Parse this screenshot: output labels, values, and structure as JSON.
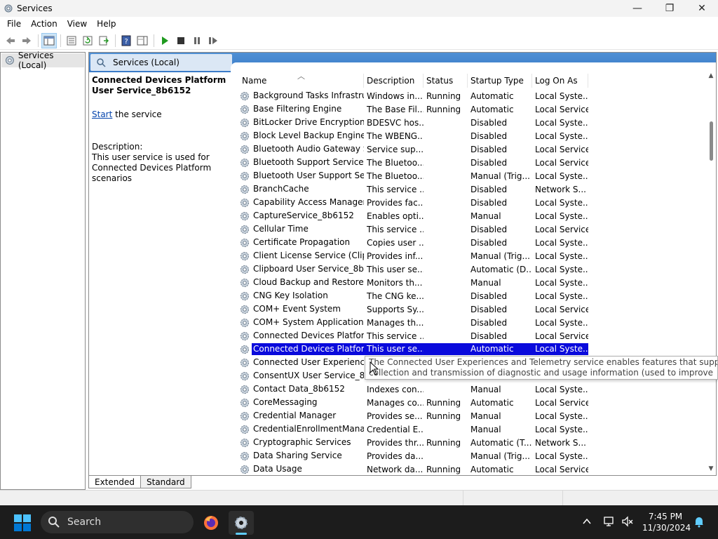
{
  "window": {
    "title": "Services",
    "minimize": "—",
    "maximize": "❐",
    "close": "✕"
  },
  "menu": [
    "File",
    "Action",
    "View",
    "Help"
  ],
  "tree": {
    "root_label": "Services (Local)"
  },
  "main_header": {
    "title": "Services (Local)"
  },
  "description": {
    "service_title": "Connected Devices Platform User Service_8b6152",
    "start_link": "Start",
    "start_suffix": " the service",
    "label": "Description:",
    "text": "This user service is used for Connected Devices Platform scenarios"
  },
  "columns": {
    "name": "Name",
    "description": "Description",
    "status": "Status",
    "startup_type": "Startup Type",
    "log_on_as": "Log On As"
  },
  "rows": [
    {
      "name": "Background Tasks Infrastru...",
      "description": "Windows in...",
      "status": "Running",
      "startup": "Automatic",
      "logon": "Local Syste..."
    },
    {
      "name": "Base Filtering Engine",
      "description": "The Base Fil...",
      "status": "Running",
      "startup": "Automatic",
      "logon": "Local Service"
    },
    {
      "name": "BitLocker Drive Encryption ...",
      "description": "BDESVC hos...",
      "status": "",
      "startup": "Disabled",
      "logon": "Local Syste..."
    },
    {
      "name": "Block Level Backup Engine ...",
      "description": "The WBENG...",
      "status": "",
      "startup": "Disabled",
      "logon": "Local Syste..."
    },
    {
      "name": "Bluetooth Audio Gateway S...",
      "description": "Service sup...",
      "status": "",
      "startup": "Disabled",
      "logon": "Local Service"
    },
    {
      "name": "Bluetooth Support Service",
      "description": "The Bluetoo...",
      "status": "",
      "startup": "Disabled",
      "logon": "Local Service"
    },
    {
      "name": "Bluetooth User Support Ser...",
      "description": "The Bluetoo...",
      "status": "",
      "startup": "Manual (Trig...",
      "logon": "Local Syste..."
    },
    {
      "name": "BranchCache",
      "description": "This service ...",
      "status": "",
      "startup": "Disabled",
      "logon": "Network S..."
    },
    {
      "name": "Capability Access Manager ...",
      "description": "Provides fac...",
      "status": "",
      "startup": "Disabled",
      "logon": "Local Syste..."
    },
    {
      "name": "CaptureService_8b6152",
      "description": "Enables opti...",
      "status": "",
      "startup": "Manual",
      "logon": "Local Syste..."
    },
    {
      "name": "Cellular Time",
      "description": "This service ...",
      "status": "",
      "startup": "Disabled",
      "logon": "Local Service"
    },
    {
      "name": "Certificate Propagation",
      "description": "Copies user ...",
      "status": "",
      "startup": "Disabled",
      "logon": "Local Syste..."
    },
    {
      "name": "Client License Service (ClipS...",
      "description": "Provides inf...",
      "status": "",
      "startup": "Manual (Trig...",
      "logon": "Local Syste..."
    },
    {
      "name": "Clipboard User Service_8b6...",
      "description": "This user se...",
      "status": "",
      "startup": "Automatic (D...",
      "logon": "Local Syste..."
    },
    {
      "name": "Cloud Backup and Restore ...",
      "description": "Monitors th...",
      "status": "",
      "startup": "Manual",
      "logon": "Local Syste..."
    },
    {
      "name": "CNG Key Isolation",
      "description": "The CNG ke...",
      "status": "",
      "startup": "Disabled",
      "logon": "Local Syste..."
    },
    {
      "name": "COM+ Event System",
      "description": "Supports Sy...",
      "status": "",
      "startup": "Disabled",
      "logon": "Local Service"
    },
    {
      "name": "COM+ System Application",
      "description": "Manages th...",
      "status": "",
      "startup": "Disabled",
      "logon": "Local Syste..."
    },
    {
      "name": "Connected Devices Platfor...",
      "description": "This service ...",
      "status": "",
      "startup": "Disabled",
      "logon": "Local Service"
    },
    {
      "name": "Connected Devices Platfor...",
      "description": "This user se...",
      "status": "",
      "startup": "Automatic",
      "logon": "Local Syste...",
      "selected": true
    },
    {
      "name": "Connected User Experience...",
      "description": "",
      "status": "",
      "startup": "",
      "logon": ""
    },
    {
      "name": "ConsentUX User Service_8b...",
      "description": "",
      "status": "",
      "startup": "",
      "logon": ""
    },
    {
      "name": "Contact Data_8b6152",
      "description": "Indexes con...",
      "status": "",
      "startup": "Manual",
      "logon": "Local Syste..."
    },
    {
      "name": "CoreMessaging",
      "description": "Manages co...",
      "status": "Running",
      "startup": "Automatic",
      "logon": "Local Service"
    },
    {
      "name": "Credential Manager",
      "description": "Provides se...",
      "status": "Running",
      "startup": "Manual",
      "logon": "Local Syste..."
    },
    {
      "name": "CredentialEnrollmentMana...",
      "description": "Credential E...",
      "status": "",
      "startup": "Manual",
      "logon": "Local Syste..."
    },
    {
      "name": "Cryptographic Services",
      "description": "Provides thr...",
      "status": "Running",
      "startup": "Automatic (T...",
      "logon": "Network S..."
    },
    {
      "name": "Data Sharing Service",
      "description": "Provides da...",
      "status": "",
      "startup": "Manual (Trig...",
      "logon": "Local Syste..."
    },
    {
      "name": "Data Usage",
      "description": "Network da...",
      "status": "Running",
      "startup": "Automatic",
      "logon": "Local Service"
    }
  ],
  "tooltip": {
    "line1": "The Connected User Experiences and Telemetry service enables features that support in-applica",
    "line2": "collection and transmission of diagnostic and usage information (used to improve"
  },
  "tabs": [
    "Extended",
    "Standard"
  ],
  "taskbar": {
    "search_label": "Search",
    "time": "7:45 PM",
    "date": "11/30/2024"
  },
  "colors": {
    "selection": "#0a0adc",
    "header_blue": "#3a7bc8",
    "taskbar": "#1c1c1c",
    "accent": "#60cdff"
  }
}
